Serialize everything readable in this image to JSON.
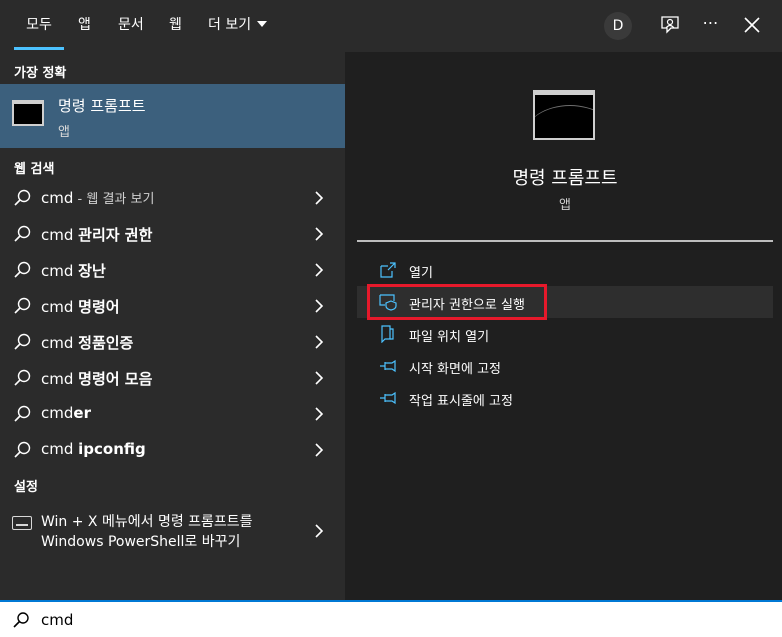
{
  "tabs": {
    "all": "모두",
    "apps": "앱",
    "docs": "문서",
    "web": "웹",
    "more": "더 보기"
  },
  "header": {
    "avatar_letter": "D",
    "icons": [
      "feedback-icon",
      "more-icon",
      "close-icon"
    ],
    "more_glyph": "⋯"
  },
  "best_match": {
    "section": "가장 정확",
    "title": "명령 프롬프트",
    "subtitle": "앱"
  },
  "web_search": {
    "section": "웹 검색",
    "items": [
      {
        "prefix": "cmd",
        "suffix": "",
        "dim": " - 웹 결과 보기"
      },
      {
        "prefix": "cmd ",
        "suffix": "관리자 권한",
        "dim": ""
      },
      {
        "prefix": "cmd ",
        "suffix": "장난",
        "dim": ""
      },
      {
        "prefix": "cmd ",
        "suffix": "명령어",
        "dim": ""
      },
      {
        "prefix": "cmd ",
        "suffix": "정품인증",
        "dim": ""
      },
      {
        "prefix": "cmd ",
        "suffix": "명령어 모음",
        "dim": ""
      },
      {
        "prefix": "cmd",
        "suffix": "er",
        "dim": ""
      },
      {
        "prefix": "cmd ",
        "suffix": "ipconfig",
        "dim": ""
      }
    ]
  },
  "settings": {
    "section": "설정",
    "line1": "Win + X 메뉴에서 명령 프롬프트를",
    "line2": "Windows PowerShell로 바꾸기"
  },
  "preview": {
    "title": "명령 프롬프트",
    "subtitle": "앱",
    "actions": [
      {
        "label": "열기",
        "icon": "open-icon"
      },
      {
        "label": "관리자 권한으로 실행",
        "icon": "shield-icon"
      },
      {
        "label": "파일 위치 열기",
        "icon": "file-location-icon"
      },
      {
        "label": "시작 화면에 고정",
        "icon": "pin-icon"
      },
      {
        "label": "작업 표시줄에 고정",
        "icon": "pin-icon"
      }
    ],
    "highlight_color": "#e6192b"
  },
  "search": {
    "query": "cmd"
  },
  "colors": {
    "accent": "#4cc2ff",
    "selected_bg": "#3c607d",
    "searchbar_border": "#0078d4"
  }
}
